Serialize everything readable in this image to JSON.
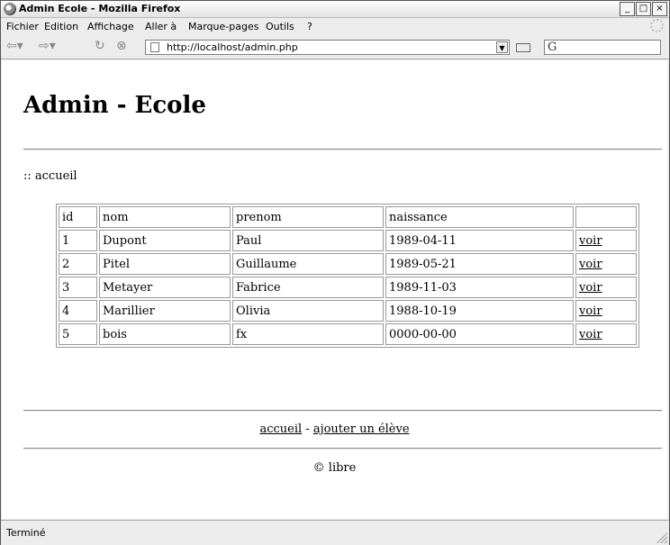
{
  "window": {
    "title": "Admin Ecole - Mozilla Firefox",
    "controls": {
      "minimize": "_",
      "maximize": "□",
      "close": "×"
    }
  },
  "menu": [
    "Fichier",
    "Edition",
    "Affichage",
    "Aller à",
    "Marque-pages",
    "Outils",
    "?"
  ],
  "toolbar": {
    "back_icon": "back-arrow-icon",
    "forward_icon": "forward-arrow-icon",
    "reload_icon": "reload-icon",
    "stop_icon": "stop-icon",
    "url": "http://localhost/admin.php",
    "search_glyph": "G"
  },
  "page": {
    "heading": "Admin - Ecole",
    "breadcrumb": ":: accueil",
    "table": {
      "headers": [
        "id",
        "nom",
        "prenom",
        "naissance",
        ""
      ],
      "rows": [
        {
          "id": "1",
          "nom": "Dupont",
          "prenom": "Paul",
          "naissance": "1989-04-11",
          "action": "voir"
        },
        {
          "id": "2",
          "nom": "Pitel",
          "prenom": "Guillaume",
          "naissance": "1989-05-21",
          "action": "voir"
        },
        {
          "id": "3",
          "nom": "Metayer",
          "prenom": "Fabrice",
          "naissance": "1989-11-03",
          "action": "voir"
        },
        {
          "id": "4",
          "nom": "Marillier",
          "prenom": "Olivia",
          "naissance": "1988-10-19",
          "action": "voir"
        },
        {
          "id": "5",
          "nom": "bois",
          "prenom": "fx",
          "naissance": "0000-00-00",
          "action": "voir"
        }
      ]
    },
    "footer": {
      "link_home": "accueil",
      "separator": "-",
      "link_add": "ajouter un élève",
      "copyright": "© libre"
    }
  },
  "status": {
    "text": "Terminé"
  }
}
